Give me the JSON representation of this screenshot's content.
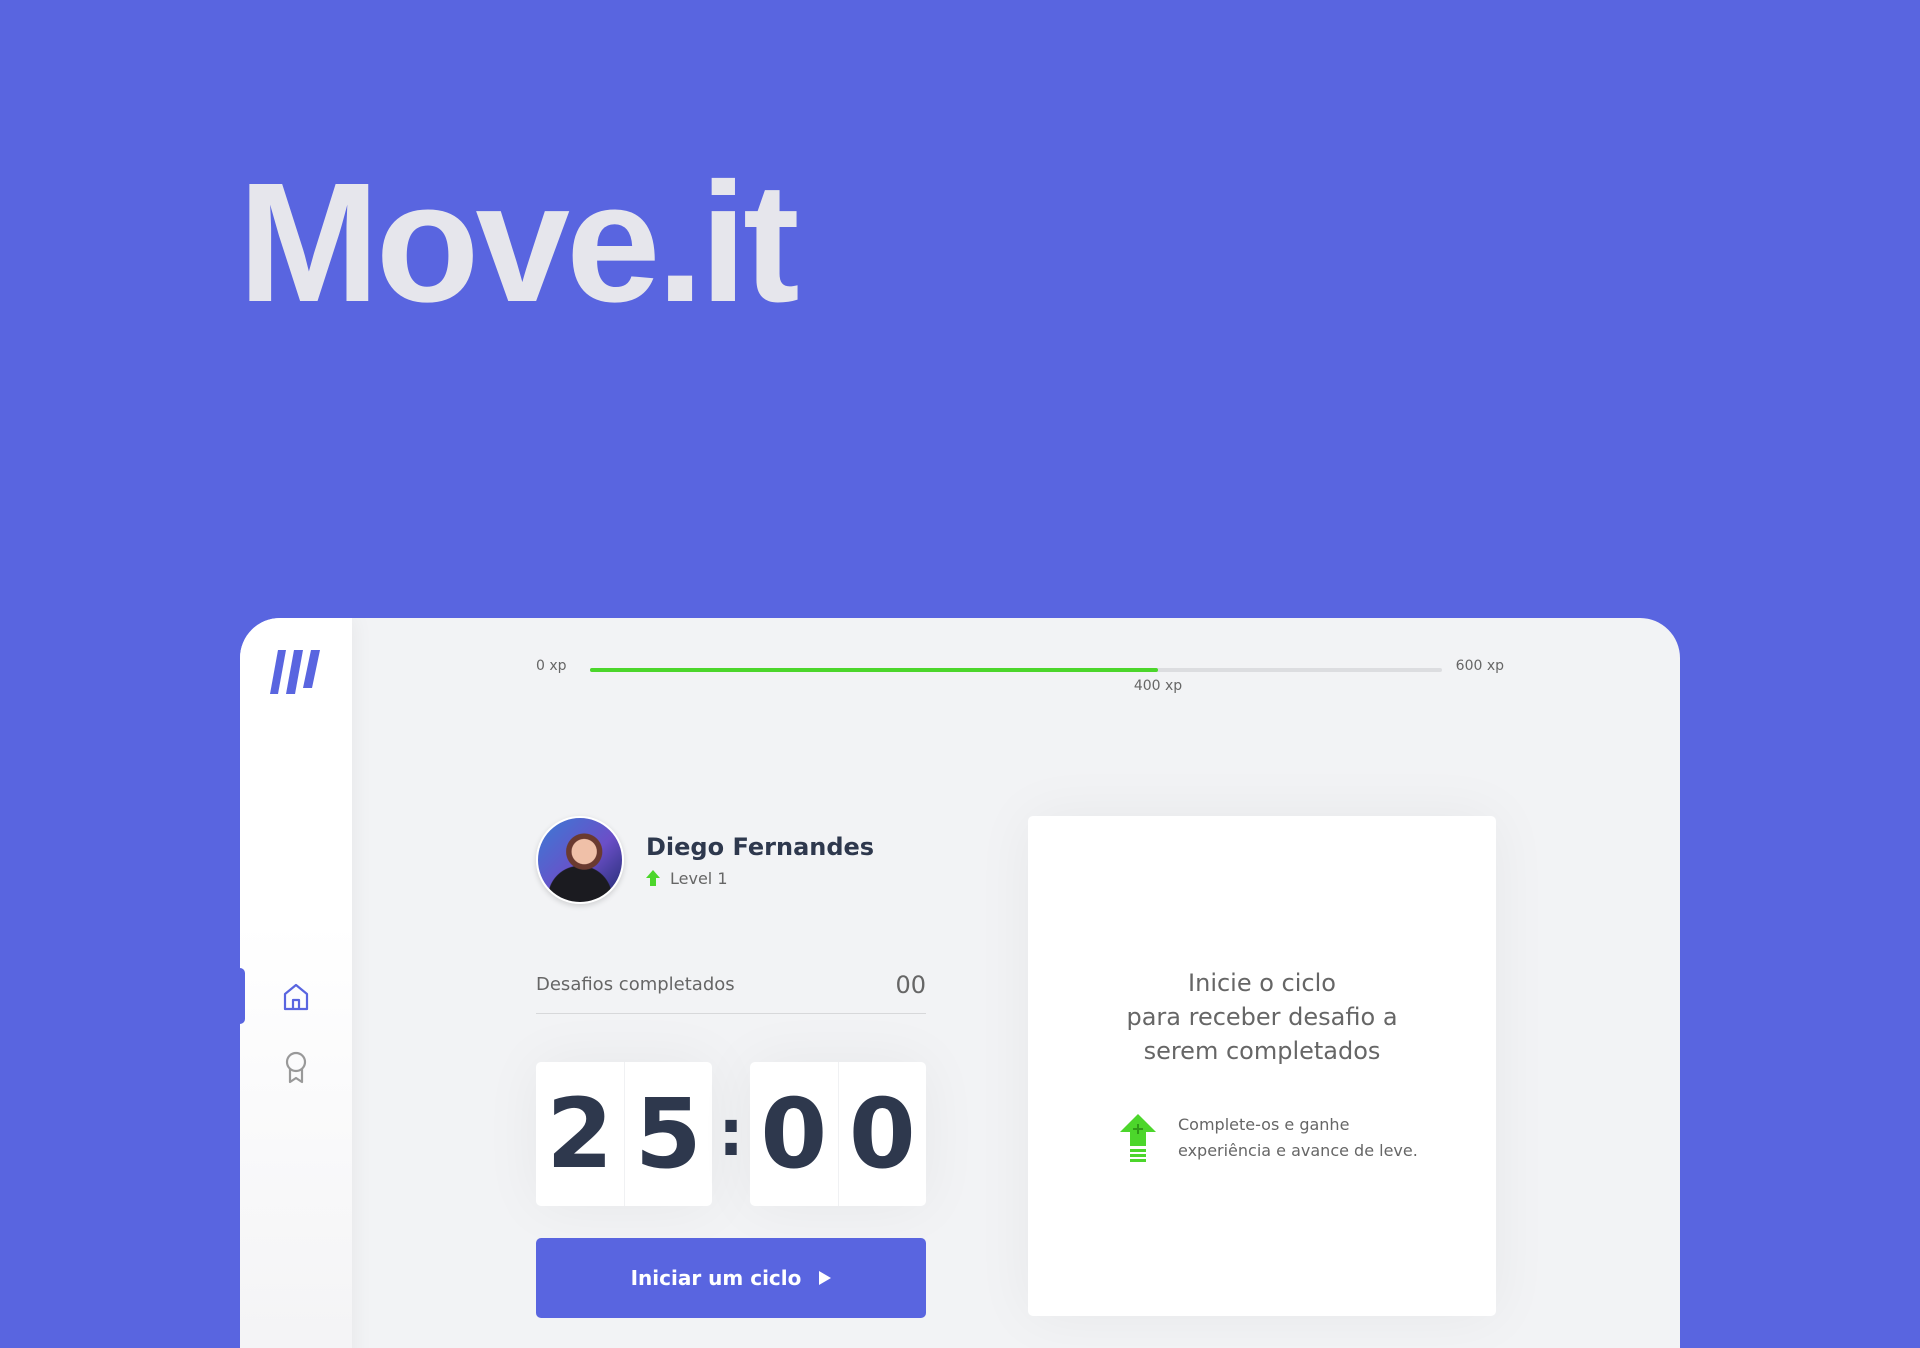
{
  "hero": {
    "title": "Move.it"
  },
  "xp": {
    "min_label": "0 xp",
    "max_label": "600 xp",
    "current_label": "400 xp",
    "progress_fraction": 0.6667
  },
  "sidebar": {
    "logo": "move-it-logo",
    "items": [
      {
        "icon": "home-icon",
        "active": true
      },
      {
        "icon": "award-icon",
        "active": false
      }
    ]
  },
  "profile": {
    "name": "Diego Fernandes",
    "level_label": "Level 1"
  },
  "completed": {
    "label": "Desafios completados",
    "count": "00"
  },
  "countdown": {
    "minute_left": "2",
    "minute_right": "5",
    "separator": ":",
    "second_left": "0",
    "second_right": "0"
  },
  "start_button": {
    "label": "Iniciar um ciclo"
  },
  "challenge": {
    "title": "Inicie o ciclo\npara receber desafio a\nserem completados",
    "hint": "Complete-os e ganhe\nexperiência e avance de leve."
  },
  "colors": {
    "background": "#5965e0",
    "accent": "#5965e0",
    "level_green": "#4cd62b",
    "text": "#666666",
    "title": "#2e384d"
  }
}
